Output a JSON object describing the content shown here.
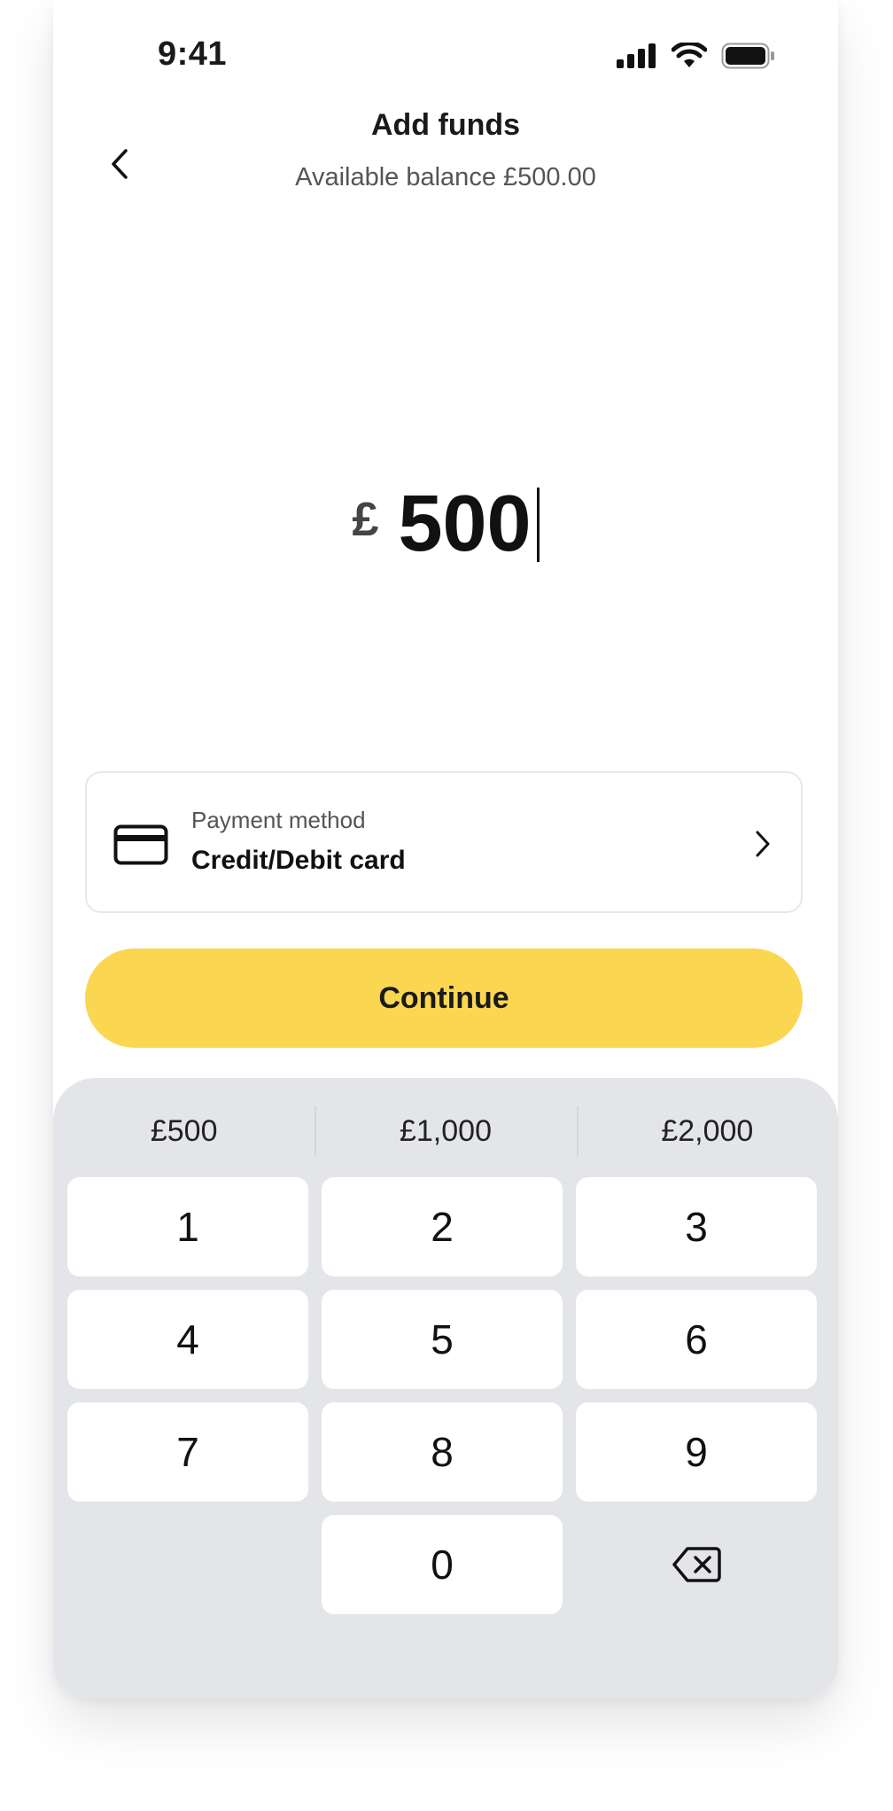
{
  "status_bar": {
    "time": "9:41"
  },
  "header": {
    "title": "Add funds",
    "subtitle": "Available balance £500.00"
  },
  "amount": {
    "currency": "£",
    "value": "500"
  },
  "payment": {
    "label": "Payment method",
    "value": "Credit/Debit card"
  },
  "continue_label": "Continue",
  "quick_amounts": [
    "£500",
    "£1,000",
    "£2,000"
  ],
  "keypad": {
    "keys": [
      "1",
      "2",
      "3",
      "4",
      "5",
      "6",
      "7",
      "8",
      "9",
      "0"
    ]
  },
  "colors": {
    "accent": "#fbd651",
    "keypad_bg": "#e3e5e9"
  },
  "icons": [
    "back-chevron-icon",
    "signal-icon",
    "wifi-icon",
    "battery-icon",
    "credit-card-icon",
    "chevron-right-icon",
    "backspace-icon"
  ]
}
